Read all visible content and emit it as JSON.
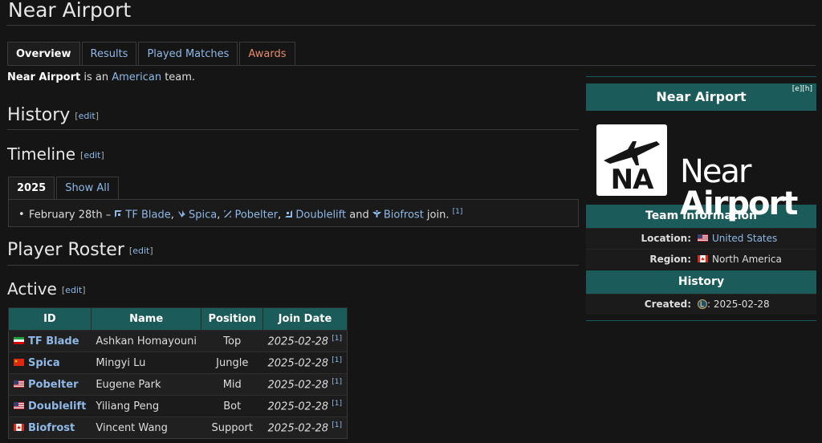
{
  "page": {
    "title": "Near Airport",
    "tabs": [
      "Overview",
      "Results",
      "Played Matches",
      "Awards"
    ],
    "intro_bold": "Near Airport",
    "intro_mid": " is an ",
    "intro_link": "American",
    "intro_end": " team."
  },
  "sections": {
    "history": "History",
    "timeline": "Timeline",
    "roster": "Player Roster",
    "active": "Active",
    "edit": "edit"
  },
  "timeline": {
    "tabs": [
      "2025",
      "Show All"
    ],
    "entry_date": "February 28th",
    "entry_dash": " – ",
    "players": [
      "TF Blade",
      "Spica",
      "Pobelter",
      "Doublelift",
      "Biofrost"
    ],
    "sep1": ", ",
    "and": " and ",
    "join": " join. ",
    "ref": "[1]"
  },
  "roster": {
    "headers": [
      "ID",
      "Name",
      "Position",
      "Join Date"
    ],
    "rows": [
      {
        "id": "TF Blade",
        "name": "Ashkan Homayouni",
        "position": "Top",
        "join": "2025-02-28",
        "ref": "[1]",
        "flag": "iran"
      },
      {
        "id": "Spica",
        "name": "Mingyi Lu",
        "position": "Jungle",
        "join": "2025-02-28",
        "ref": "[1]",
        "flag": "china"
      },
      {
        "id": "Pobelter",
        "name": "Eugene Park",
        "position": "Mid",
        "join": "2025-02-28",
        "ref": "[1]",
        "flag": "usa"
      },
      {
        "id": "Doublelift",
        "name": "Yiliang Peng",
        "position": "Bot",
        "join": "2025-02-28",
        "ref": "[1]",
        "flag": "usa"
      },
      {
        "id": "Biofrost",
        "name": "Vincent Wang",
        "position": "Support",
        "join": "2025-02-28",
        "ref": "[1]",
        "flag": "canada"
      }
    ]
  },
  "infobox": {
    "title": "Near Airport",
    "edit_links": "[e][h]",
    "logo_initials": "NA",
    "logo_line1": "Near",
    "logo_line2": "Airport",
    "section_info": "Team Information",
    "location_label": "Location:",
    "location_value": "United States",
    "region_label": "Region:",
    "region_value": "North America",
    "section_history": "History",
    "created_label": "Created:",
    "created_value": ": 2025-02-28"
  },
  "colors": {
    "accent": "#1b5c5a",
    "link": "#8fb8e6",
    "background": "#151515"
  }
}
